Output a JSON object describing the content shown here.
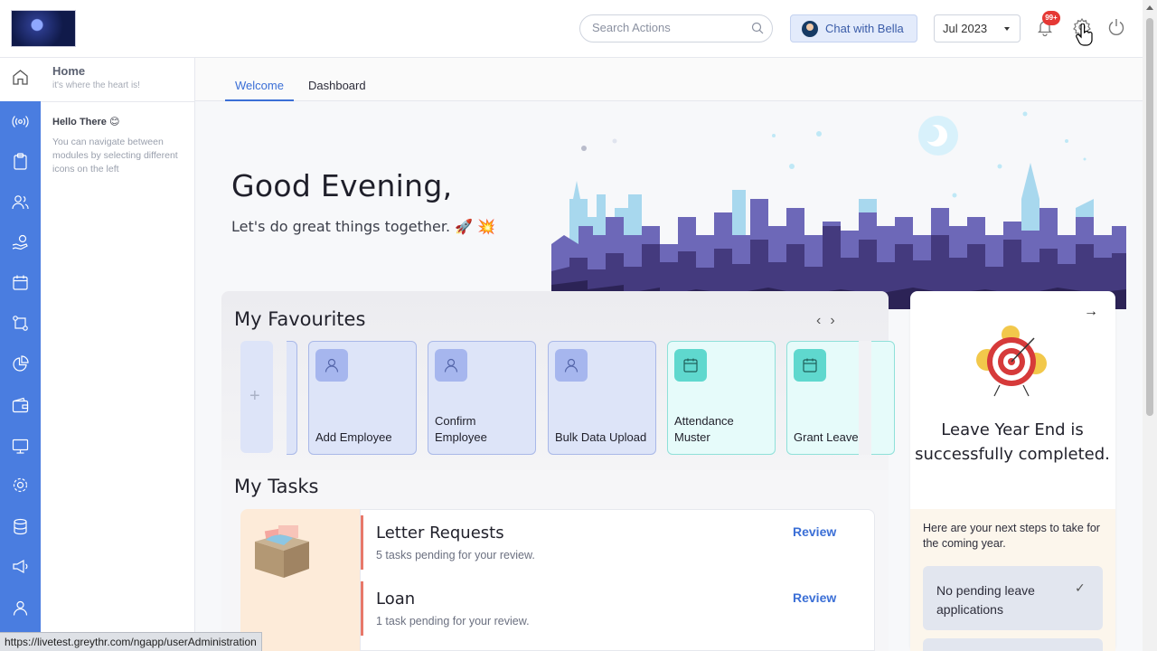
{
  "topbar": {
    "search_placeholder": "Search Actions",
    "chat_label": "Chat with Bella",
    "period": "Jul 2023",
    "notification_count": "99+",
    "icons": [
      "search-icon",
      "bell-icon",
      "gear-icon",
      "power-icon"
    ]
  },
  "rail": {
    "icons": [
      "home-icon",
      "broadcast-icon",
      "clipboard-icon",
      "users-icon",
      "hand-coin-icon",
      "calendar-icon",
      "route-icon",
      "pie-chart-icon",
      "wallet-icon",
      "monitor-icon",
      "cog-icon",
      "database-icon",
      "megaphone-icon",
      "person-icon"
    ]
  },
  "panel": {
    "home_title": "Home",
    "home_subtitle": "it's where the heart is!",
    "hello_title": "Hello There 😊",
    "hello_text": "You can navigate between modules by selecting different icons on the left"
  },
  "tabs": [
    {
      "label": "Welcome",
      "active": true
    },
    {
      "label": "Dashboard",
      "active": false
    }
  ],
  "hero": {
    "greeting": "Good Evening,",
    "subtitle": "Let's do great things together. 🚀 💥"
  },
  "favourites": {
    "title": "My Favourites",
    "prev": "‹",
    "next": "›",
    "add": "+",
    "items": [
      {
        "label": "Add Employee",
        "icon": "person-icon",
        "color": "blue"
      },
      {
        "label": "Confirm Employee",
        "icon": "person-icon",
        "color": "blue"
      },
      {
        "label": "Bulk Data Upload",
        "icon": "person-icon",
        "color": "blue"
      },
      {
        "label": "Attendance Muster",
        "icon": "calendar-icon",
        "color": "teal"
      },
      {
        "label": "Grant Leave",
        "icon": "calendar-icon",
        "color": "teal"
      }
    ]
  },
  "tasks": {
    "title": "My Tasks",
    "items": [
      {
        "title": "Letter Requests",
        "subtitle": "5 tasks pending for your review.",
        "action": "Review"
      },
      {
        "title": "Loan",
        "subtitle": "1 task pending for your review.",
        "action": "Review"
      }
    ]
  },
  "leave_card": {
    "title": "Leave Year End is successfully completed.",
    "next_steps": "Here are your next steps to take for the coming year.",
    "item_label": "No pending leave applications",
    "item_check": "✓",
    "arrow": "→"
  },
  "status_url": "https://livetest.greythr.com/ngapp/userAdministration"
}
